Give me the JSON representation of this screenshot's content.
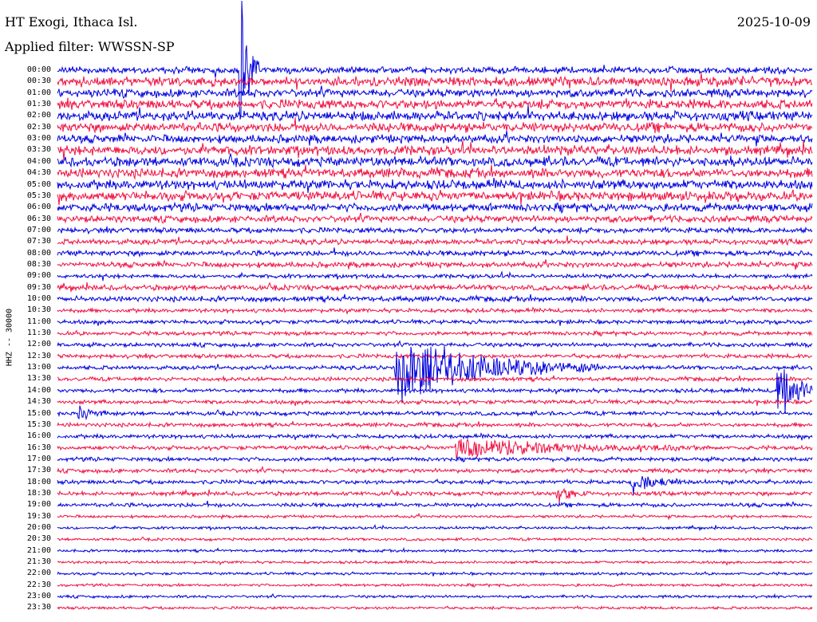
{
  "header": {
    "station": "HT Exogi, Ithaca Isl.",
    "date": "2025-10-09",
    "filter": "Applied filter: WWSSN-SP"
  },
  "channel_label": "HHZ -- 30000",
  "colors": {
    "odd": "#0000dd",
    "even": "#ee1144",
    "background": "#ffffff"
  },
  "chart_data": {
    "type": "line",
    "title": "HT Exogi, Ithaca Isl.",
    "subtitle": "2025-10-09",
    "ylabel": "HHZ -- 30000",
    "row_labels": [
      "00:00",
      "00:30",
      "01:00",
      "01:30",
      "02:00",
      "02:30",
      "03:00",
      "03:30",
      "04:00",
      "04:30",
      "05:00",
      "05:30",
      "06:00",
      "06:30",
      "07:00",
      "07:30",
      "08:00",
      "08:30",
      "09:00",
      "09:30",
      "10:00",
      "10:30",
      "11:00",
      "11:30",
      "12:00",
      "12:30",
      "13:00",
      "13:30",
      "14:00",
      "14:30",
      "15:00",
      "15:30",
      "16:00",
      "16:30",
      "17:00",
      "17:30",
      "18:00",
      "18:30",
      "19:00",
      "19:30",
      "20:00",
      "20:30",
      "21:00",
      "21:30",
      "22:00",
      "22:30",
      "23:00",
      "23:30"
    ],
    "row_minutes": 30,
    "noise_level": [
      5,
      7,
      6,
      7,
      7,
      7,
      6,
      7,
      7,
      7,
      7,
      7,
      6,
      5,
      4,
      4,
      4,
      4,
      3,
      4,
      4,
      3,
      3,
      3,
      3,
      3,
      3,
      3,
      3,
      3,
      3,
      3,
      3,
      3,
      3,
      3,
      3,
      3,
      3,
      2,
      2,
      2,
      2,
      2,
      2,
      2,
      2,
      2
    ],
    "events": [
      {
        "row": 0,
        "minute": 7.4,
        "amplitude": 90,
        "duration_min": 0.6
      },
      {
        "row": 26,
        "minute": 13.6,
        "amplitude": 50,
        "duration_min": 8
      },
      {
        "row": 28,
        "minute": 28.8,
        "amplitude": 40,
        "duration_min": 2
      },
      {
        "row": 30,
        "minute": 1.0,
        "amplitude": 12,
        "duration_min": 1
      },
      {
        "row": 33,
        "minute": 16,
        "amplitude": 14,
        "duration_min": 10
      },
      {
        "row": 36,
        "minute": 23,
        "amplitude": 15,
        "duration_min": 2
      },
      {
        "row": 37,
        "minute": 20,
        "amplitude": 12,
        "duration_min": 1
      }
    ]
  }
}
